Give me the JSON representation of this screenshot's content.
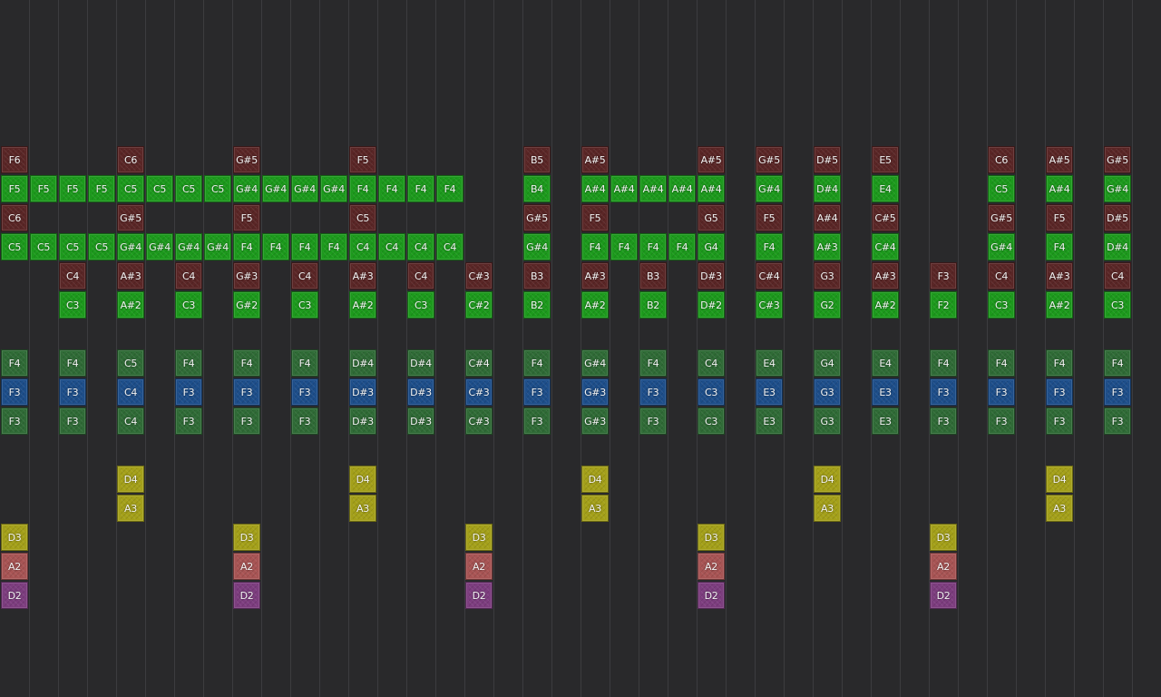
{
  "colors": {
    "background": "#29292b",
    "gridline": "#3c3c3f",
    "green": "#1c9a1c",
    "red": "#5a2626",
    "sage": "#2f6b36",
    "blue": "#1d4e8a",
    "yellow": "#a4a019",
    "pink": "#a85454",
    "purple": "#7d3d7f"
  },
  "rows": [
    {
      "color": "red",
      "notes": [
        [
          0,
          "F6"
        ],
        [
          4,
          "C6"
        ],
        [
          8,
          "G#5"
        ],
        [
          12,
          "F5"
        ],
        [
          18,
          "B5"
        ],
        [
          20,
          "A#5"
        ],
        [
          24,
          "A#5"
        ],
        [
          26,
          "G#5"
        ],
        [
          28,
          "D#5"
        ],
        [
          30,
          "E5"
        ],
        [
          34,
          "C6"
        ],
        [
          36,
          "A#5"
        ],
        [
          38,
          "G#5"
        ]
      ]
    },
    {
      "color": "green",
      "notes": [
        [
          0,
          "F5"
        ],
        [
          1,
          "F5"
        ],
        [
          2,
          "F5"
        ],
        [
          3,
          "F5"
        ],
        [
          4,
          "C5"
        ],
        [
          5,
          "C5"
        ],
        [
          6,
          "C5"
        ],
        [
          7,
          "C5"
        ],
        [
          8,
          "G#4"
        ],
        [
          9,
          "G#4"
        ],
        [
          10,
          "G#4"
        ],
        [
          11,
          "G#4"
        ],
        [
          12,
          "F4"
        ],
        [
          13,
          "F4"
        ],
        [
          14,
          "F4"
        ],
        [
          15,
          "F4"
        ],
        [
          18,
          "B4"
        ],
        [
          20,
          "A#4"
        ],
        [
          21,
          "A#4"
        ],
        [
          22,
          "A#4"
        ],
        [
          23,
          "A#4"
        ],
        [
          24,
          "A#4"
        ],
        [
          26,
          "G#4"
        ],
        [
          28,
          "D#4"
        ],
        [
          30,
          "E4"
        ],
        [
          34,
          "C5"
        ],
        [
          36,
          "A#4"
        ],
        [
          38,
          "G#4"
        ]
      ]
    },
    {
      "color": "red",
      "notes": [
        [
          0,
          "C6"
        ],
        [
          4,
          "G#5"
        ],
        [
          8,
          "F5"
        ],
        [
          12,
          "C5"
        ],
        [
          18,
          "G#5"
        ],
        [
          20,
          "F5"
        ],
        [
          24,
          "G5"
        ],
        [
          26,
          "F5"
        ],
        [
          28,
          "A#4"
        ],
        [
          30,
          "C#5"
        ],
        [
          34,
          "G#5"
        ],
        [
          36,
          "F5"
        ],
        [
          38,
          "D#5"
        ]
      ]
    },
    {
      "color": "green",
      "notes": [
        [
          0,
          "C5"
        ],
        [
          1,
          "C5"
        ],
        [
          2,
          "C5"
        ],
        [
          3,
          "C5"
        ],
        [
          4,
          "G#4"
        ],
        [
          5,
          "G#4"
        ],
        [
          6,
          "G#4"
        ],
        [
          7,
          "G#4"
        ],
        [
          8,
          "F4"
        ],
        [
          9,
          "F4"
        ],
        [
          10,
          "F4"
        ],
        [
          11,
          "F4"
        ],
        [
          12,
          "C4"
        ],
        [
          13,
          "C4"
        ],
        [
          14,
          "C4"
        ],
        [
          15,
          "C4"
        ],
        [
          18,
          "G#4"
        ],
        [
          20,
          "F4"
        ],
        [
          21,
          "F4"
        ],
        [
          22,
          "F4"
        ],
        [
          23,
          "F4"
        ],
        [
          24,
          "G4"
        ],
        [
          26,
          "F4"
        ],
        [
          28,
          "A#3"
        ],
        [
          30,
          "C#4"
        ],
        [
          34,
          "G#4"
        ],
        [
          36,
          "F4"
        ],
        [
          38,
          "D#4"
        ]
      ]
    },
    {
      "color": "red",
      "notes": [
        [
          2,
          "C4"
        ],
        [
          4,
          "A#3"
        ],
        [
          6,
          "C4"
        ],
        [
          8,
          "G#3"
        ],
        [
          10,
          "C4"
        ],
        [
          12,
          "A#3"
        ],
        [
          14,
          "C4"
        ],
        [
          16,
          "C#3"
        ],
        [
          18,
          "B3"
        ],
        [
          20,
          "A#3"
        ],
        [
          22,
          "B3"
        ],
        [
          24,
          "D#3"
        ],
        [
          26,
          "C#4"
        ],
        [
          28,
          "G3"
        ],
        [
          30,
          "A#3"
        ],
        [
          32,
          "F3"
        ],
        [
          34,
          "C4"
        ],
        [
          36,
          "A#3"
        ],
        [
          38,
          "C4"
        ]
      ]
    },
    {
      "color": "green",
      "notes": [
        [
          2,
          "C3"
        ],
        [
          4,
          "A#2"
        ],
        [
          6,
          "C3"
        ],
        [
          8,
          "G#2"
        ],
        [
          10,
          "C3"
        ],
        [
          12,
          "A#2"
        ],
        [
          14,
          "C3"
        ],
        [
          16,
          "C#2"
        ],
        [
          18,
          "B2"
        ],
        [
          20,
          "A#2"
        ],
        [
          22,
          "B2"
        ],
        [
          24,
          "D#2"
        ],
        [
          26,
          "C#3"
        ],
        [
          28,
          "G2"
        ],
        [
          30,
          "A#2"
        ],
        [
          32,
          "F2"
        ],
        [
          34,
          "C3"
        ],
        [
          36,
          "A#2"
        ],
        [
          38,
          "C3"
        ]
      ]
    },
    {
      "color": "none",
      "notes": []
    },
    {
      "color": "sage",
      "notes": [
        [
          0,
          "F4"
        ],
        [
          2,
          "F4"
        ],
        [
          4,
          "C5"
        ],
        [
          6,
          "F4"
        ],
        [
          8,
          "F4"
        ],
        [
          10,
          "F4"
        ],
        [
          12,
          "D#4"
        ],
        [
          14,
          "D#4"
        ],
        [
          16,
          "C#4"
        ],
        [
          18,
          "F4"
        ],
        [
          20,
          "G#4"
        ],
        [
          22,
          "F4"
        ],
        [
          24,
          "C4"
        ],
        [
          26,
          "E4"
        ],
        [
          28,
          "G4"
        ],
        [
          30,
          "E4"
        ],
        [
          32,
          "F4"
        ],
        [
          34,
          "F4"
        ],
        [
          36,
          "F4"
        ],
        [
          38,
          "F4"
        ]
      ]
    },
    {
      "color": "blue",
      "notes": [
        [
          0,
          "F3"
        ],
        [
          2,
          "F3"
        ],
        [
          4,
          "C4"
        ],
        [
          6,
          "F3"
        ],
        [
          8,
          "F3"
        ],
        [
          10,
          "F3"
        ],
        [
          12,
          "D#3"
        ],
        [
          14,
          "D#3"
        ],
        [
          16,
          "C#3"
        ],
        [
          18,
          "F3"
        ],
        [
          20,
          "G#3"
        ],
        [
          22,
          "F3"
        ],
        [
          24,
          "C3"
        ],
        [
          26,
          "E3"
        ],
        [
          28,
          "G3"
        ],
        [
          30,
          "E3"
        ],
        [
          32,
          "F3"
        ],
        [
          34,
          "F3"
        ],
        [
          36,
          "F3"
        ],
        [
          38,
          "F3"
        ]
      ]
    },
    {
      "color": "sage",
      "notes": [
        [
          0,
          "F3"
        ],
        [
          2,
          "F3"
        ],
        [
          4,
          "C4"
        ],
        [
          6,
          "F3"
        ],
        [
          8,
          "F3"
        ],
        [
          10,
          "F3"
        ],
        [
          12,
          "D#3"
        ],
        [
          14,
          "D#3"
        ],
        [
          16,
          "C#3"
        ],
        [
          18,
          "F3"
        ],
        [
          20,
          "G#3"
        ],
        [
          22,
          "F3"
        ],
        [
          24,
          "C3"
        ],
        [
          26,
          "E3"
        ],
        [
          28,
          "G3"
        ],
        [
          30,
          "E3"
        ],
        [
          32,
          "F3"
        ],
        [
          34,
          "F3"
        ],
        [
          36,
          "F3"
        ],
        [
          38,
          "F3"
        ]
      ]
    },
    {
      "color": "none",
      "notes": []
    },
    {
      "color": "yellow",
      "notes": [
        [
          4,
          "D4"
        ],
        [
          12,
          "D4"
        ],
        [
          20,
          "D4"
        ],
        [
          28,
          "D4"
        ],
        [
          36,
          "D4"
        ]
      ]
    },
    {
      "color": "yellow",
      "notes": [
        [
          4,
          "A3"
        ],
        [
          12,
          "A3"
        ],
        [
          20,
          "A3"
        ],
        [
          28,
          "A3"
        ],
        [
          36,
          "A3"
        ]
      ]
    },
    {
      "color": "yellow",
      "notes": [
        [
          0,
          "D3"
        ],
        [
          8,
          "D3"
        ],
        [
          16,
          "D3"
        ],
        [
          24,
          "D3"
        ],
        [
          32,
          "D3"
        ]
      ]
    },
    {
      "color": "pink",
      "notes": [
        [
          0,
          "A2"
        ],
        [
          8,
          "A2"
        ],
        [
          16,
          "A2"
        ],
        [
          24,
          "A2"
        ],
        [
          32,
          "A2"
        ]
      ]
    },
    {
      "color": "purple",
      "notes": [
        [
          0,
          "D2"
        ],
        [
          8,
          "D2"
        ],
        [
          16,
          "D2"
        ],
        [
          24,
          "D2"
        ],
        [
          32,
          "D2"
        ]
      ]
    }
  ]
}
